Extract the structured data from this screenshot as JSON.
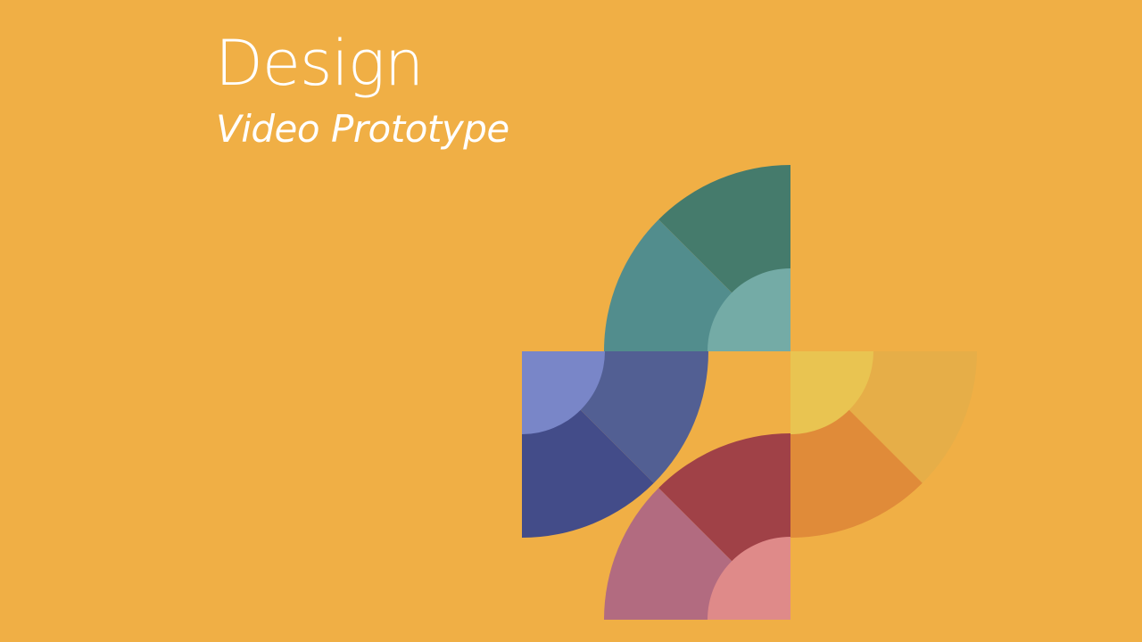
{
  "slide": {
    "title": "Design",
    "subtitle": "Video Prototype"
  },
  "colors": {
    "background": "#F0AF45",
    "text": "#FFFFFF",
    "teal_dark": "#457B6C",
    "teal_mid": "#528D8D",
    "teal_light": "#74ABA6",
    "blue_dark": "#434C89",
    "blue_mid": "#525F93",
    "blue_light": "#7986C8",
    "yellow_light": "#E9C451",
    "yellow_mid": "#E6AE48",
    "orange": "#E08B39",
    "red_dark": "#A04147",
    "mauve": "#B26B80",
    "pink": "#DF8A89"
  }
}
